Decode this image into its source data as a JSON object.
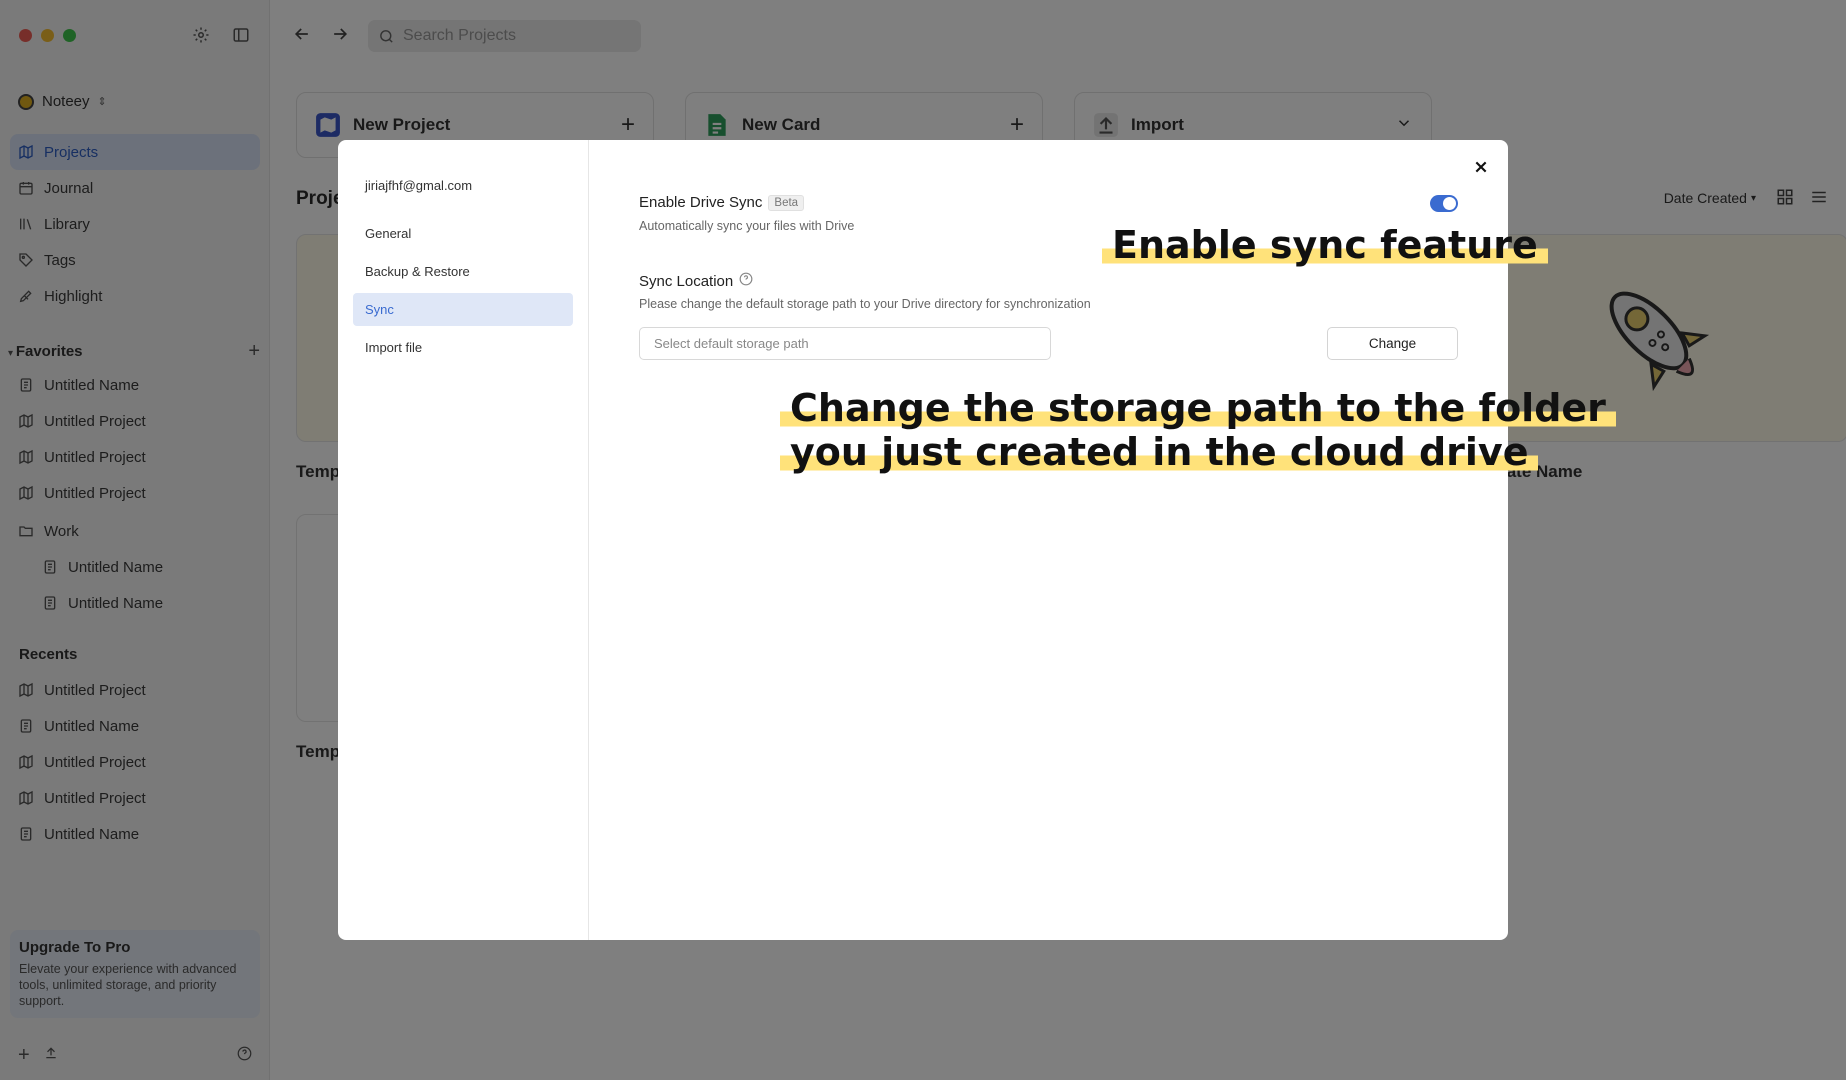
{
  "sidebar": {
    "workspace": "Noteey",
    "nav": [
      "Projects",
      "Journal",
      "Library",
      "Tags",
      "Highlight"
    ],
    "favorites_label": "Favorites",
    "favorites": [
      "Untitled Name",
      "Untitled Project",
      "Untitled Project",
      "Untitled Project"
    ],
    "work_folder": "Work",
    "work_items": [
      "Untitled Name",
      "Untitled Name"
    ],
    "recents_label": "Recents",
    "recents": [
      "Untitled Project",
      "Untitled Name",
      "Untitled Project",
      "Untitled Project",
      "Untitled Name"
    ],
    "upgrade": {
      "title": "Upgrade To Pro",
      "text": "Elevate your experience with advanced tools, unlimited storage, and priority support."
    }
  },
  "topbar": {
    "search_placeholder": "Search Projects"
  },
  "quick_actions": {
    "new_project": "New Project",
    "new_card": "New Card",
    "import": "Import"
  },
  "projects": {
    "title": "Proje",
    "sort_label": "Date Created",
    "cards": [
      "Temp",
      "Temp",
      "late Name"
    ]
  },
  "modal": {
    "email": "jiriajfhf@gmal.com",
    "menu": [
      "General",
      "Backup & Restore",
      "Sync",
      "Import file"
    ],
    "active_item": "Sync",
    "sync": {
      "enable_title": "Enable Drive Sync",
      "beta_badge": "Beta",
      "enable_desc": "Automatically sync your files with Drive",
      "enabled": true,
      "location_title": "Sync Location",
      "location_desc": "Please change the default storage path to your Drive directory for synchronization",
      "path_placeholder": "Select default storage path",
      "change_button": "Change"
    }
  },
  "annotations": {
    "first": "Enable sync feature",
    "second_line1": "Change the storage path to the folder",
    "second_line2": "you just created in the cloud drive"
  },
  "colors": {
    "accent": "#3a6bd0",
    "highlight": "#ffe27a",
    "overlay": "rgba(0,0,0,0.5)"
  }
}
